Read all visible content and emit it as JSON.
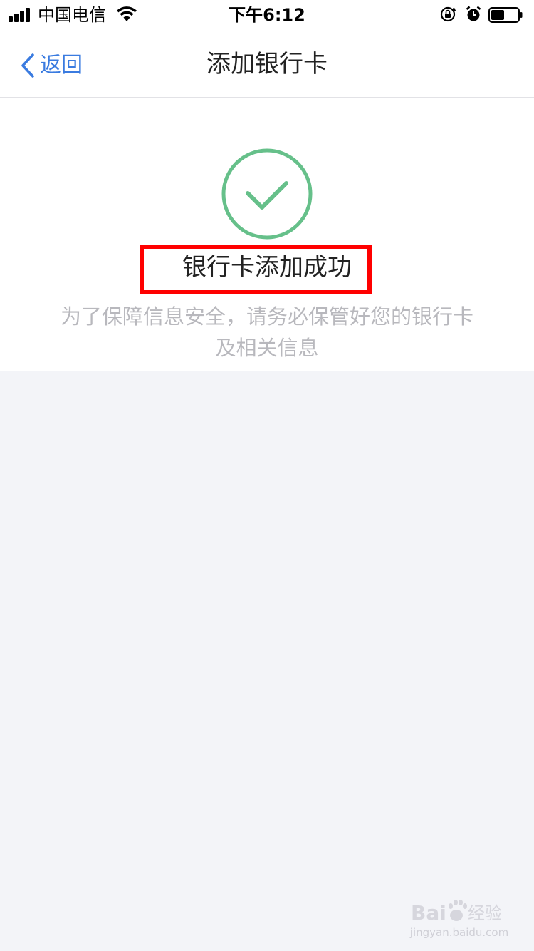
{
  "status_bar": {
    "carrier": "中国电信",
    "time": "下午6:12",
    "battery_level": 0.5,
    "signal_bars": 4
  },
  "nav": {
    "back_label": "返回",
    "title": "添加银行卡"
  },
  "success": {
    "title": "银行卡添加成功",
    "description": "为了保障信息安全，请务必保管好您的银行卡及相关信息",
    "icon": "check-circle-icon",
    "icon_color": "#66c08a",
    "highlight_color": "#ff0000"
  },
  "watermark": {
    "logo_text": "Baidu经验",
    "url": "jingyan.baidu.com"
  },
  "colors": {
    "accent": "#3a7be0",
    "background": "#f3f4f8",
    "muted_text": "#b8b8bd"
  }
}
